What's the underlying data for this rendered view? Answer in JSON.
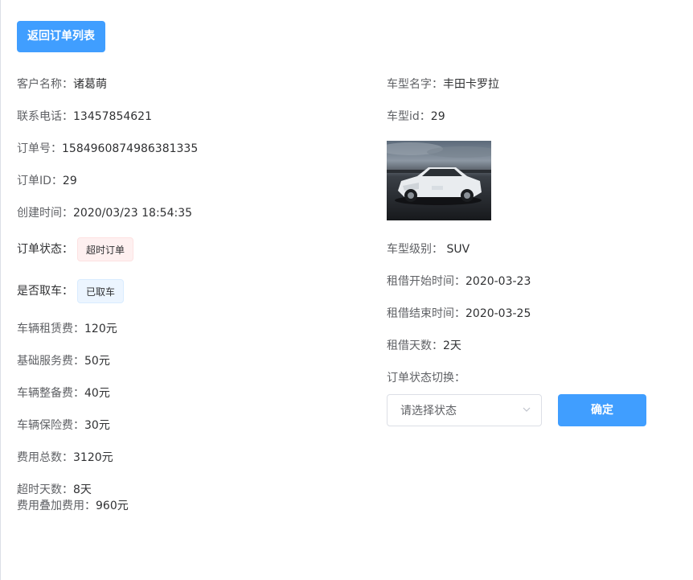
{
  "back_button": "返回订单列表",
  "left": {
    "customer_name": {
      "label": "客户名称：",
      "value": "诸葛萌"
    },
    "phone": {
      "label": "联系电话：",
      "value": "13457854621"
    },
    "order_no": {
      "label": "订单号：",
      "value": "1584960874986381335"
    },
    "order_id": {
      "label": "订单ID：",
      "value": "29"
    },
    "created_at": {
      "label": "创建时间：",
      "value": "2020/03/23 18:54:35"
    },
    "order_status": {
      "label": "订单状态：",
      "tag": "超时订单"
    },
    "picked_up": {
      "label": "是否取车：",
      "tag": "已取车"
    },
    "rental_fee": {
      "label": "车辆租赁费：",
      "value": "120元"
    },
    "service_fee": {
      "label": "基础服务费：",
      "value": "50元"
    },
    "prep_fee": {
      "label": "车辆整备费：",
      "value": "40元"
    },
    "insurance_fee": {
      "label": "车辆保险费：",
      "value": "30元"
    },
    "total_fee": {
      "label": "费用总数：",
      "value": "3120元"
    },
    "overtime_days": {
      "label": "超时天数：",
      "value": "8天"
    },
    "extra_fee": {
      "label": "费用叠加费用：",
      "value": "960元"
    }
  },
  "right": {
    "car_name": {
      "label": "车型名字：",
      "value": "丰田卡罗拉"
    },
    "car_id": {
      "label": "车型id：",
      "value": "29"
    },
    "car_level": {
      "label": "车型级别：",
      "value": "SUV"
    },
    "start_time": {
      "label": "租借开始时间：",
      "value": "2020-03-23"
    },
    "end_time": {
      "label": "租借结束时间：",
      "value": "2020-03-25"
    },
    "days": {
      "label": "租借天数：",
      "value": "2天"
    },
    "status_switch_label": "订单状态切换：",
    "status_select_placeholder": "请选择状态",
    "confirm_button": "确定"
  },
  "colors": {
    "primary": "#409eff",
    "danger_tag_bg": "#fef0f0",
    "primary_tag_bg": "#ecf5ff"
  }
}
